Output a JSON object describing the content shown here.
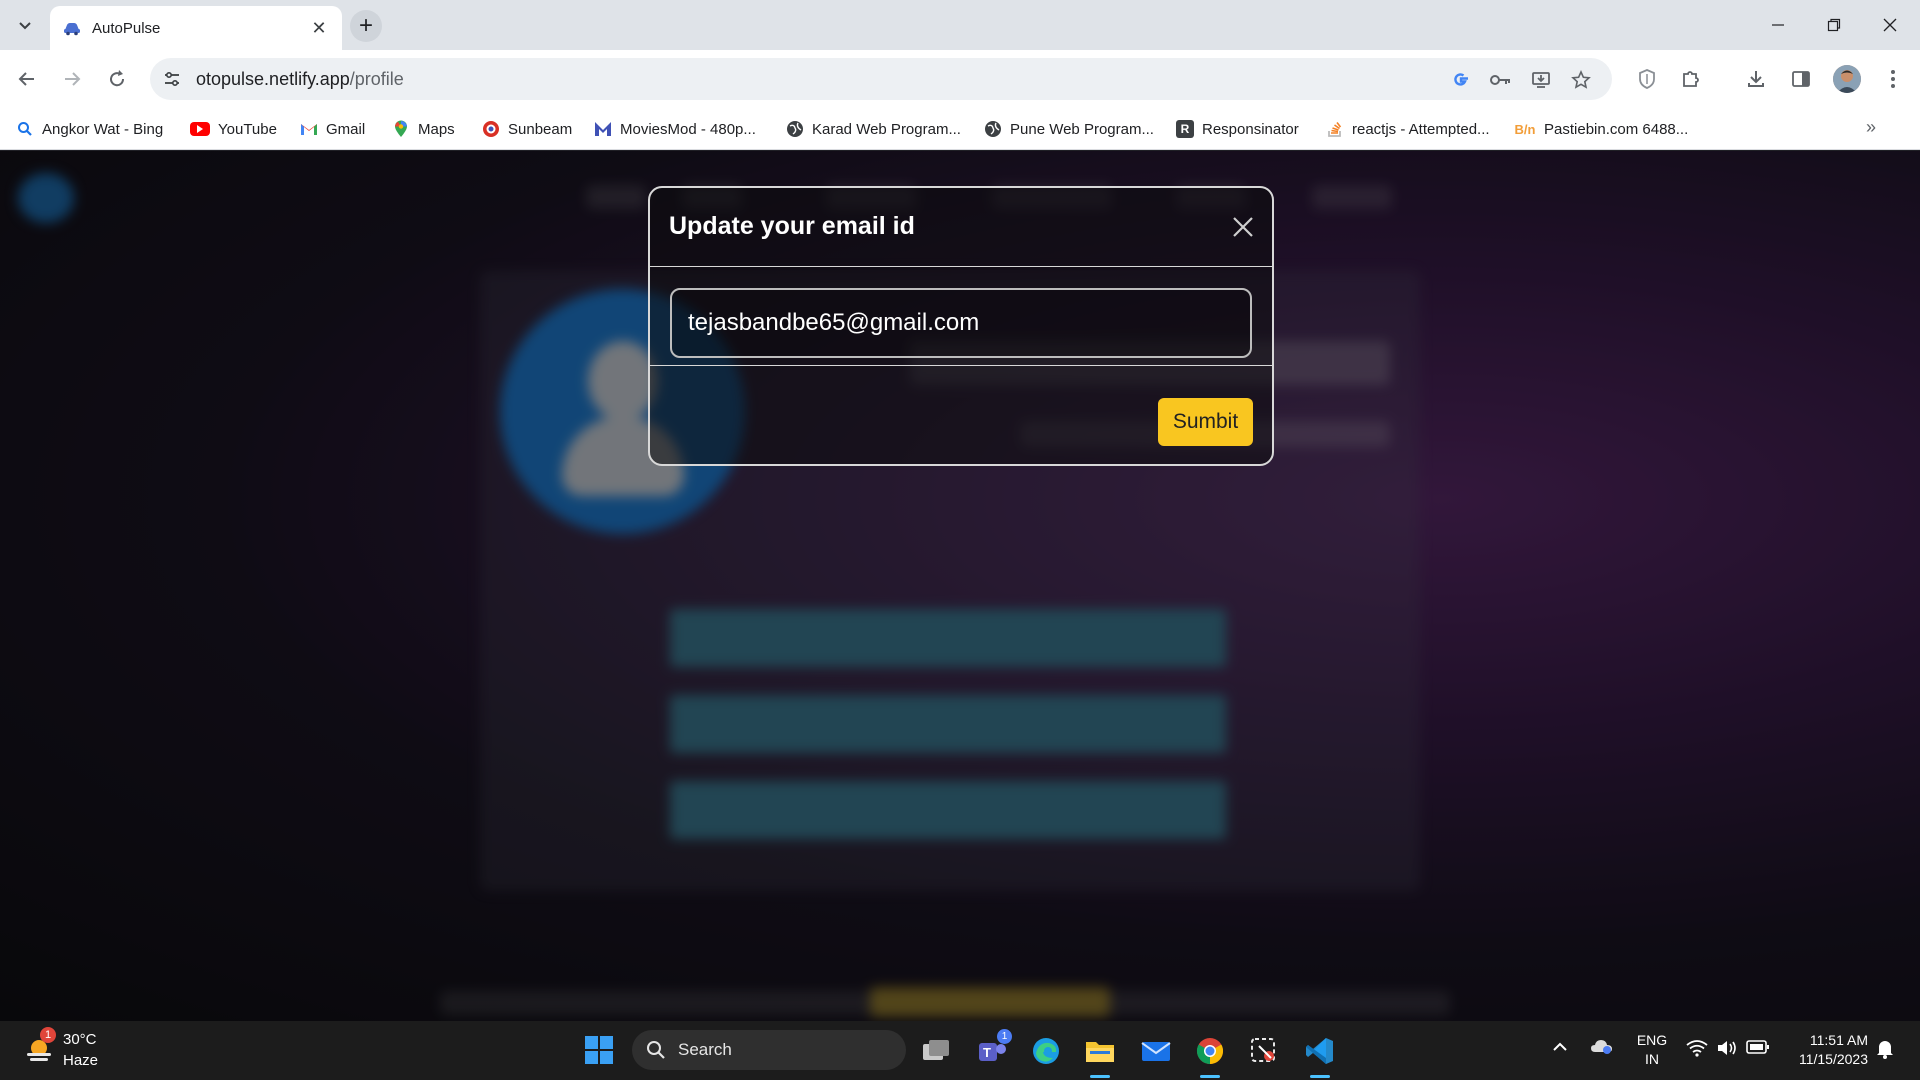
{
  "browser": {
    "tab_title": "AutoPulse",
    "url_host": "otopulse.netlify.app",
    "url_path": "/profile",
    "bookmarks": [
      {
        "label": "Angkor Wat - Bing",
        "icon": "bing-search-icon",
        "color": "#1a73e8"
      },
      {
        "label": "YouTube",
        "icon": "youtube-icon",
        "color": "#ff0000"
      },
      {
        "label": "Gmail",
        "icon": "gmail-icon",
        "color": "#ea4335"
      },
      {
        "label": "Maps",
        "icon": "maps-pin-icon",
        "color": "#34a853"
      },
      {
        "label": "Sunbeam",
        "icon": "sunbeam-icon",
        "color": "#d93025"
      },
      {
        "label": "MoviesMod - 480p...",
        "icon": "moviesmod-icon",
        "color": "#3f51b5"
      },
      {
        "label": "Karad Web Program...",
        "icon": "globe-icon",
        "color": "#3c4043"
      },
      {
        "label": "Pune Web Program...",
        "icon": "globe-icon",
        "color": "#3c4043"
      },
      {
        "label": "Responsinator",
        "icon": "responsinator-icon",
        "color": "#3c4043"
      },
      {
        "label": "reactjs - Attempted...",
        "icon": "stackoverflow-icon",
        "color": "#f48024"
      },
      {
        "label": "Pastiebin.com 6488...",
        "icon": "pastiebin-icon",
        "color": "#f29d38"
      }
    ]
  },
  "modal": {
    "title": "Update your email id",
    "email_value": "tejasbandbe65@gmail.com",
    "submit_label": "Sumbit",
    "submit_color": "#f9c620"
  },
  "taskbar": {
    "weather_temp": "30°C",
    "weather_desc": "Haze",
    "weather_badge": "1",
    "search_label": "Search",
    "teams_badge": "1",
    "lang_line1": "ENG",
    "lang_line2": "IN",
    "time": "11:51 AM",
    "date": "11/15/2023"
  }
}
